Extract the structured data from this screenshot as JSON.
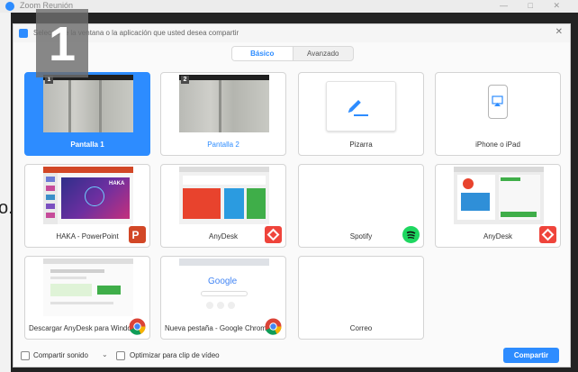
{
  "background_window": {
    "title": "Zoom Reunión",
    "controls": "— □ ✕",
    "edge_letter": "o."
  },
  "overlay_number": "1",
  "dialog": {
    "title": "Seleccione la ventana o la aplicación que usted desea compartir",
    "close_glyph": "✕",
    "tabs": [
      {
        "label": "Básico",
        "active": true
      },
      {
        "label": "Avanzado",
        "active": false
      }
    ],
    "tiles": [
      {
        "label": "Pantalla 1",
        "kind": "screen",
        "screen_number": "1",
        "selected": true
      },
      {
        "label": "Pantalla 2",
        "kind": "screen",
        "screen_number": "2",
        "selected": false
      },
      {
        "label": "Pizarra",
        "kind": "whiteboard",
        "selected": false
      },
      {
        "label": "iPhone o iPad",
        "kind": "iphone",
        "selected": false
      },
      {
        "label": "HAKA - PowerPoint",
        "kind": "app",
        "app_icon": "powerpoint-icon",
        "selected": false
      },
      {
        "label": "AnyDesk",
        "kind": "app",
        "app_icon": "anydesk-icon",
        "selected": false
      },
      {
        "label": "Spotify",
        "kind": "app",
        "app_icon": "spotify-icon",
        "selected": false
      },
      {
        "label": "AnyDesk",
        "kind": "app",
        "app_icon": "anydesk-icon",
        "selected": false
      },
      {
        "label": "Descargar AnyDesk para Window...",
        "kind": "app",
        "app_icon": "chrome-icon",
        "selected": false
      },
      {
        "label": "Nueva pestaña - Google Chrome",
        "kind": "app",
        "app_icon": "chrome-icon",
        "selected": false
      },
      {
        "label": "Correo",
        "kind": "app",
        "selected": false
      }
    ],
    "thumb_text": {
      "haka_logo": "HAKA",
      "google_logo": "Google"
    },
    "footer": {
      "share_sound_label": "Compartir sonido",
      "share_sound_caret": "⌄",
      "optimize_video_label": "Optimizar para clip de vídeo",
      "share_button": "Compartir"
    }
  },
  "colors": {
    "accent": "#2d8cff",
    "anydesk": "#ef443b",
    "powerpoint": "#d24726",
    "spotify": "#1ed760"
  }
}
